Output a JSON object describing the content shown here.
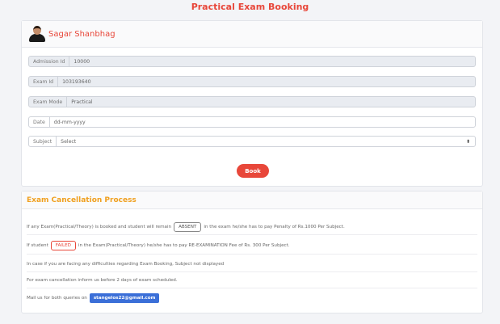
{
  "page_title": "Practical Exam Booking",
  "user": {
    "name": "Sagar Shanbhag"
  },
  "form": {
    "admission": {
      "label": "Admission Id",
      "value": "10000"
    },
    "exam_id": {
      "label": "Exam Id",
      "value": "103193640"
    },
    "exam_mode": {
      "label": "Exam Mode",
      "value": "Practical"
    },
    "date": {
      "label": "Date",
      "placeholder": "dd-mm-yyyy"
    },
    "subject": {
      "label": "Subject",
      "selected": "Select"
    },
    "book_label": "Book"
  },
  "cancellation": {
    "title": "Exam Cancellation Process",
    "row1": {
      "before": "If any Exam(Practical/Theory) is booked and student will remain",
      "badge": "ABSENT",
      "after": "in the exam he/she has to pay Penalty of Rs.1000 Per Subject."
    },
    "row2": {
      "before": "If student",
      "badge": "FAILED",
      "after": "in the Exam(Practical/Theory) he/she has to pay RE-EXAMINATION Fee of Rs. 300 Per Subject."
    },
    "row3": "In case if you are facing any difficulties regarding Exam Booking, Subject not displayed",
    "row4": "For exam cancellation inform us before 2 days of exam scheduled.",
    "row5": {
      "text": "Mail us for both queries on",
      "email": "stangelos22@gmail.com"
    }
  },
  "colors": {
    "accent": "#e8473a",
    "section_title": "#f0a020",
    "email_button": "#3b6fd8"
  },
  "icons": {
    "avatar": "user-photo"
  }
}
